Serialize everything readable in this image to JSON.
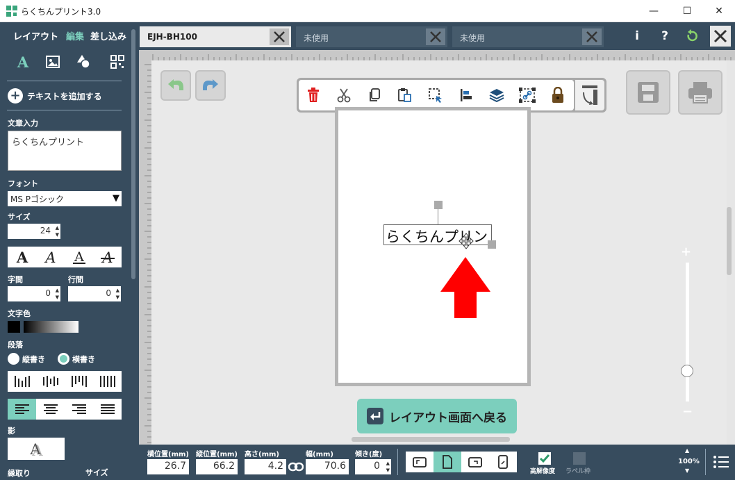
{
  "window": {
    "title": "らくちんプリント3.0",
    "minimize": "—",
    "maximize": "☐",
    "close": "✕"
  },
  "mode_tabs": [
    "レイアウト",
    "編集",
    "差し込み"
  ],
  "active_mode": "編集",
  "tool_icons": [
    "text-icon",
    "image-icon",
    "shape-icon",
    "qrcode-icon"
  ],
  "left": {
    "add_text": "テキストを追加する",
    "text_input_label": "文章入力",
    "text_input_value": "らくちんプリント",
    "font_label": "フォント",
    "font_value": "MS Pゴシック",
    "size_label": "サイズ",
    "size_value": "24",
    "char_spacing_label": "字間",
    "char_spacing_value": "0",
    "line_spacing_label": "行間",
    "line_spacing_value": "0",
    "text_color_label": "文字色",
    "paragraph_label": "段落",
    "vertical_label": "縦書き",
    "horizontal_label": "横書き",
    "writing_mode": "横書き",
    "shadow_label": "影",
    "outline_label": "縁取り",
    "outline_size_label": "サイズ",
    "style_glyph": "A",
    "text_color": "#000000"
  },
  "tabs": [
    {
      "label": "EJH-BH100",
      "active": true
    },
    {
      "label": "未使用",
      "active": false
    },
    {
      "label": "未使用",
      "active": false
    }
  ],
  "header_icons": {
    "info": "i",
    "help": "?"
  },
  "canvas": {
    "text_object": "らくちんプリント",
    "back_button": "レイアウト画面へ戻る",
    "zoom_plus": "+",
    "zoom_minus": "−",
    "zoom_level": 0.22
  },
  "bottom": {
    "x_label": "横位置(mm)",
    "x_value": "26.7",
    "y_label": "縦位置(mm)",
    "y_value": "66.2",
    "height_label": "高さ(mm)",
    "height_value": "4.2",
    "width_label": "幅(mm)",
    "width_value": "70.6",
    "angle_label": "傾き(度)",
    "angle_value": "0",
    "hires_label": "高解像度",
    "label_frame_label": "ラベル枠",
    "zoom": "100%"
  },
  "colors": {
    "panel": "#374c5e",
    "accent": "#7ccfbd",
    "delete": "#e02020",
    "arrow": "#ff0000",
    "lock": "#6b4a1e"
  }
}
